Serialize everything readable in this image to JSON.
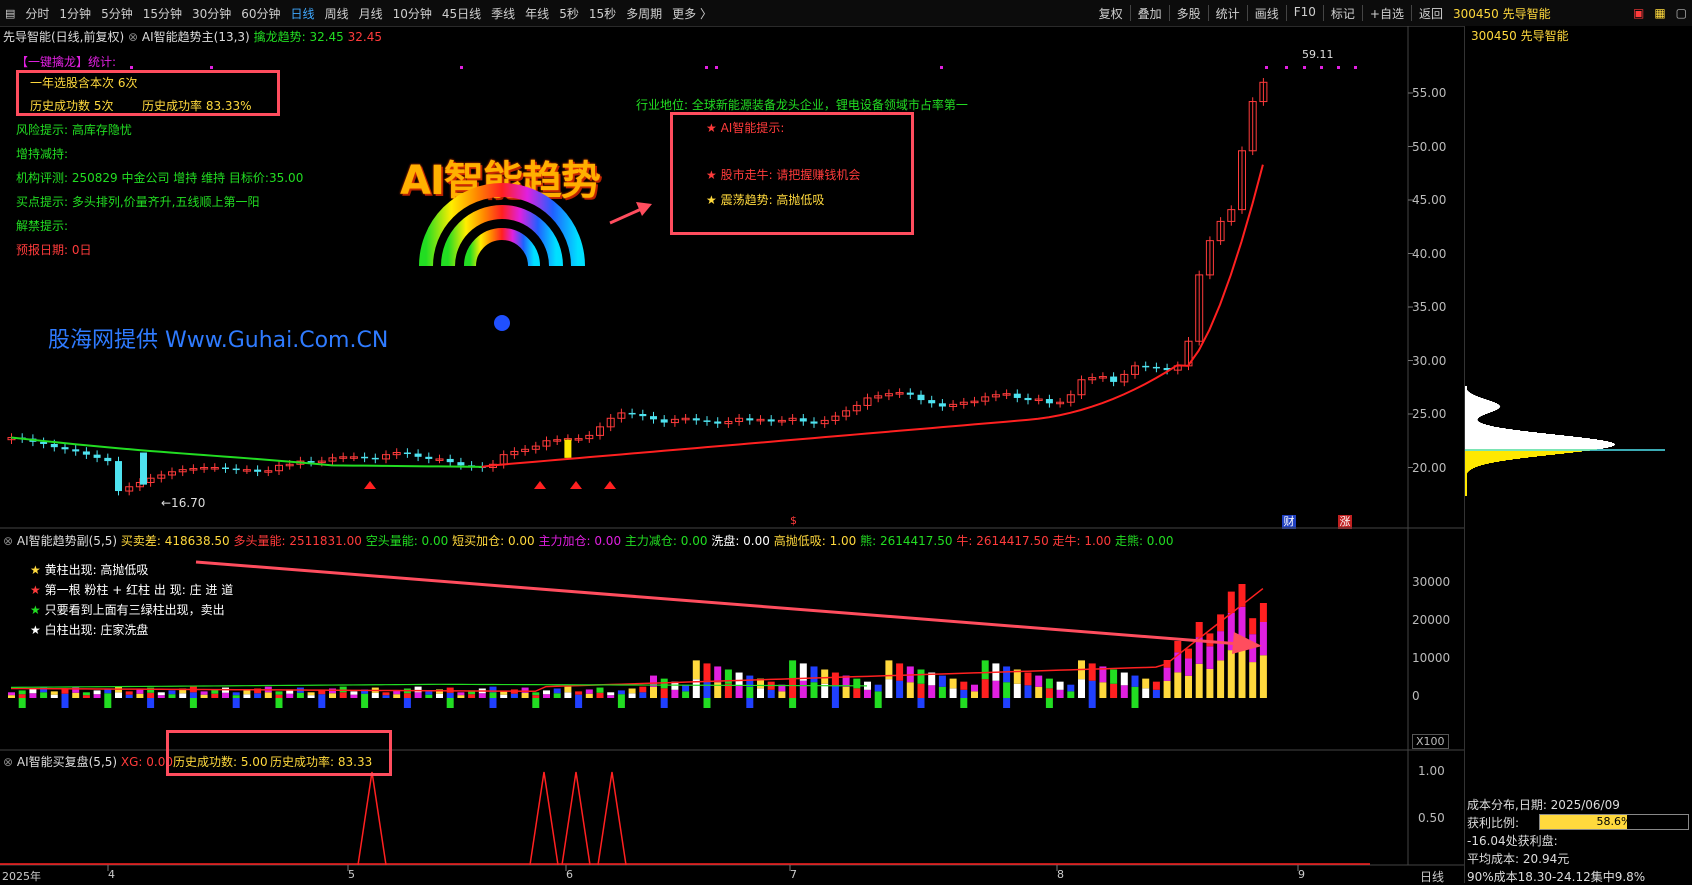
{
  "toolbar": {
    "periods": [
      "分时",
      "1分钟",
      "5分钟",
      "15分钟",
      "30分钟",
      "60分钟",
      "日线",
      "周线",
      "月线",
      "10分钟",
      "45日线",
      "季线",
      "年线",
      "5秒",
      "15秒",
      "多周期",
      "更多 〉"
    ],
    "active_period": "日线",
    "actions": [
      "复权",
      "叠加",
      "多股",
      "统计",
      "画线",
      "F10",
      "标记",
      "+自选",
      "返回"
    ],
    "stock_code_name": "300450 先导智能"
  },
  "main_panel": {
    "title": "先导智能(日线,前复权)",
    "indicator_name": "AI智能趋势主(13,3)",
    "indicator_label": "擒龙趋势:",
    "indicator_v1": "32.45",
    "indicator_v2": "32.45",
    "stats": {
      "header": "【一键擒龙】统计:",
      "line1": "一年选股含本次 6次",
      "line2a": "历史成功数 5次",
      "line2b": "历史成功率 83.33%"
    },
    "info_lines": [
      {
        "label": "风险提示:",
        "value": "高库存隐忧"
      },
      {
        "label": "增持减持:",
        "value": ""
      },
      {
        "label": "机构评测:",
        "value": "250829 中金公司 增持 维持 目标价:35.00"
      },
      {
        "label": "买点提示:",
        "value": "多头排列,价量齐升,五线顺上第一阳"
      },
      {
        "label": "解禁提示:",
        "value": ""
      },
      {
        "label": "预报日期:",
        "value": "0日"
      }
    ],
    "ai_title": "AI智能趋势",
    "watermark": "股海网提供 Www.Guhai.Com.CN",
    "industry": "行业地位: 全球新能源装备龙头企业，锂电设备领域市占率第一",
    "ai_tips": {
      "header": "★ AI智能提示:",
      "line1": "★ 股市走牛: 请把握赚钱机会",
      "line2": "★ 震荡趋势: 高抛低吸"
    },
    "high_label": "59.11",
    "low_label": "←16.70",
    "price_axis": [
      "55.00",
      "50.00",
      "45.00",
      "40.00",
      "35.00",
      "30.00",
      "25.00",
      "20.00"
    ],
    "badges": [
      "财",
      "涨"
    ]
  },
  "sub_panel": {
    "title": "AI智能趋势副(5,5)",
    "values": [
      {
        "label": "买卖差:",
        "value": "418638.50",
        "color": "#ffd93d"
      },
      {
        "label": "多头量能:",
        "value": "2511831.00",
        "color": "#ff3b3b"
      },
      {
        "label": "空头量能:",
        "value": "0.00",
        "color": "#22dd22"
      },
      {
        "label": "短买加仓:",
        "value": "0.00",
        "color": "#ffd93d"
      },
      {
        "label": "主力加仓:",
        "value": "0.00",
        "color": "#e020e0"
      },
      {
        "label": "主力减仓:",
        "value": "0.00",
        "color": "#22dd22"
      },
      {
        "label": "洗盘:",
        "value": "0.00",
        "color": "#ffffff"
      },
      {
        "label": "高抛低吸:",
        "value": "1.00",
        "color": "#ffd93d"
      },
      {
        "label": "熊:",
        "value": "2614417.50",
        "color": "#22dd22"
      },
      {
        "label": "牛:",
        "value": "2614417.50",
        "color": "#ff3b3b"
      },
      {
        "label": "走牛:",
        "value": "1.00",
        "color": "#ff3b3b"
      },
      {
        "label": "走熊:",
        "value": "0.00",
        "color": "#22dd22"
      }
    ],
    "legend": [
      {
        "star_color": "#ffd93d",
        "text": "黄柱出现:  高抛低吸"
      },
      {
        "star_color": "#ff3b3b",
        "text": "第一根 粉柱 + 红柱 出 现: 庄 进 道"
      },
      {
        "star_color": "#22dd22",
        "text": "只要看到上面有三绿柱出现，卖出"
      },
      {
        "star_color": "#ffffff",
        "text": "白柱出现:   庄家洗盘"
      }
    ],
    "axis": [
      "30000",
      "20000",
      "10000",
      "0"
    ],
    "scale": "X100"
  },
  "bottom_panel": {
    "title": "AI智能买复盘(5,5)",
    "xg": "XG: 0.00",
    "success_count": "历史成功数: 5.00",
    "success_rate": "历史成功率: 83.33",
    "axis": [
      "1.00",
      "0.50"
    ]
  },
  "x_axis": {
    "labels": [
      "2025年",
      "4",
      "5",
      "6",
      "7",
      "8",
      "9"
    ],
    "period": "日线"
  },
  "chip": {
    "date_label": "成本分布,日期: 2025/06/09",
    "profit_label": "获利比例:",
    "profit_value": "58.6%",
    "profit_fraction": 0.586,
    "line3": "-16.04处获利盘:",
    "avg_cost": "平均成本: 20.94元",
    "concentration": "90%成本18.30-24.12集中9.8%"
  }
}
